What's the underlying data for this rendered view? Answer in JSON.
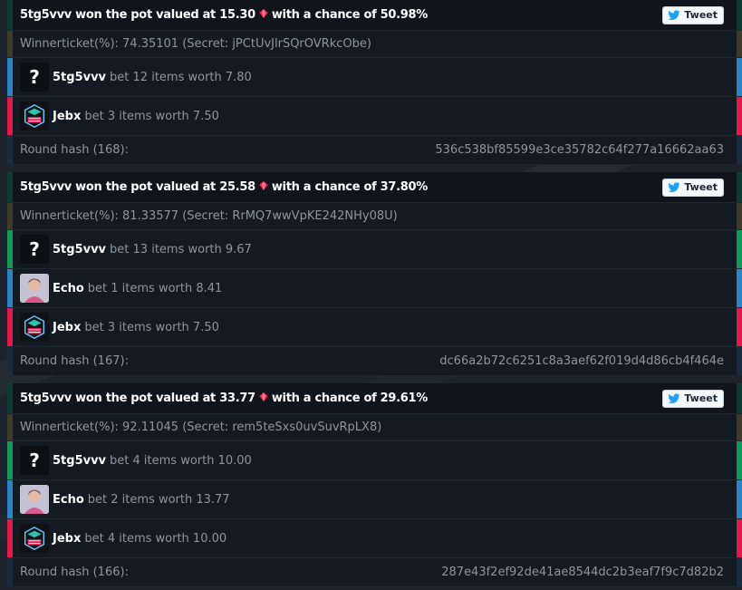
{
  "colors": {
    "green": "#0f9b5c",
    "olive": "#3f3b2a",
    "blue": "#2a84c8",
    "red": "#e3194d",
    "navy": "#1a2c40",
    "dark_teal": "#0e3b33"
  },
  "rounds": [
    {
      "header": {
        "winner": "5tg5vvv",
        "pre": "won the pot valued at",
        "value": "15.30",
        "mid": "with a chance of",
        "chance": "50.98%"
      },
      "tweet_label": "Tweet",
      "ticket": "Winnerticket(%): 74.35101 (Secret: jPCtUvJlrSQrOVRkcObe)",
      "bets": [
        {
          "avatar": "question-avatar",
          "player": "5tg5vvv",
          "text": "bet 12 items worth 7.80"
        },
        {
          "avatar": "jebx-avatar",
          "player": "Jebx",
          "text": "bet 3 items worth 7.50"
        }
      ],
      "hash_label": "Round hash (168):",
      "hash_value": "536c538bf85599e3ce35782c64f277a16662aa63"
    },
    {
      "header": {
        "winner": "5tg5vvv",
        "pre": "won the pot valued at",
        "value": "25.58",
        "mid": "with a chance of",
        "chance": "37.80%"
      },
      "tweet_label": "Tweet",
      "ticket": "Winnerticket(%): 81.33577 (Secret: RrMQ7wwVpKE242NHy08U)",
      "bets": [
        {
          "avatar": "question-avatar",
          "player": "5tg5vvv",
          "text": "bet 13 items worth 9.67"
        },
        {
          "avatar": "echo-avatar",
          "player": "Echo",
          "text": "bet 1 items worth 8.41"
        },
        {
          "avatar": "jebx-avatar",
          "player": "Jebx",
          "text": "bet 3 items worth 7.50"
        }
      ],
      "hash_label": "Round hash (167):",
      "hash_value": "dc66a2b72c6251c8a3aef62f019d4d86cb4f464e"
    },
    {
      "header": {
        "winner": "5tg5vvv",
        "pre": "won the pot valued at",
        "value": "33.77",
        "mid": "with a chance of",
        "chance": "29.61%"
      },
      "tweet_label": "Tweet",
      "ticket": "Winnerticket(%): 92.11045 (Secret: rem5teSxs0uvSuvRpLX8)",
      "bets": [
        {
          "avatar": "question-avatar",
          "player": "5tg5vvv",
          "text": "bet 4 items worth 10.00"
        },
        {
          "avatar": "echo-avatar",
          "player": "Echo",
          "text": "bet 2 items worth 13.77"
        },
        {
          "avatar": "jebx-avatar",
          "player": "Jebx",
          "text": "bet 4 items worth 10.00"
        }
      ],
      "hash_label": "Round hash (166):",
      "hash_value": "287e43f2ef92de41ae8544dc2b3eaf7f9c7d82b2"
    }
  ]
}
